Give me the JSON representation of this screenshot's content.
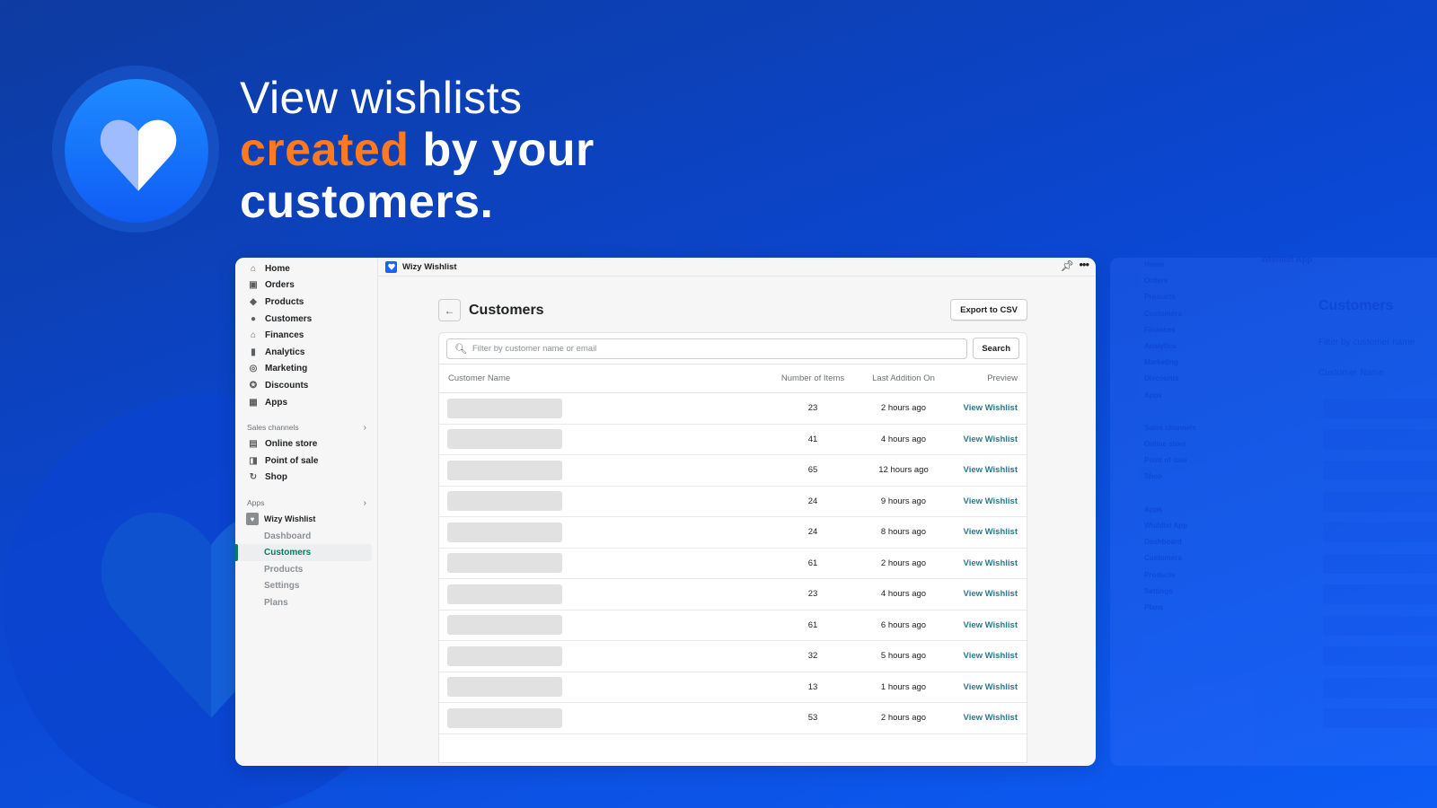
{
  "hero": {
    "line1": "View wishlists",
    "line2_accent": "created",
    "line2_rest": " by your",
    "line3": "customers.",
    "accent_color": "#ff7a1f",
    "logo_icon": "heart-icon"
  },
  "app": {
    "topbar": {
      "app_name": "Wizy Wishlist",
      "pin_icon": "pin-icon",
      "more_icon": "more-icon"
    },
    "sidebar": {
      "main_items": [
        {
          "label": "Home",
          "icon": "home-icon"
        },
        {
          "label": "Orders",
          "icon": "orders-icon"
        },
        {
          "label": "Products",
          "icon": "tag-icon"
        },
        {
          "label": "Customers",
          "icon": "person-icon"
        },
        {
          "label": "Finances",
          "icon": "bank-icon"
        },
        {
          "label": "Analytics",
          "icon": "bar-chart-icon"
        },
        {
          "label": "Marketing",
          "icon": "target-icon"
        },
        {
          "label": "Discounts",
          "icon": "discount-icon"
        },
        {
          "label": "Apps",
          "icon": "apps-icon"
        }
      ],
      "sales_channels_label": "Sales channels",
      "sales_channels": [
        {
          "label": "Online store",
          "icon": "store-icon"
        },
        {
          "label": "Point of sale",
          "icon": "pos-icon"
        },
        {
          "label": "Shop",
          "icon": "shop-icon"
        }
      ],
      "apps_label": "Apps",
      "app_name": "Wizy Wishlist",
      "app_subitems": [
        {
          "label": "Dashboard",
          "active": false
        },
        {
          "label": "Customers",
          "active": true
        },
        {
          "label": "Products",
          "active": false
        },
        {
          "label": "Settings",
          "active": false
        },
        {
          "label": "Plans",
          "active": false
        }
      ]
    },
    "page": {
      "title": "Customers",
      "export_label": "Export to CSV",
      "search_placeholder": "Filter by customer name or email",
      "search_button": "Search",
      "columns": [
        "Customer Name",
        "Number of Items",
        "Last Addition On",
        "Preview"
      ],
      "rows": [
        {
          "items": "23",
          "last": "2 hours ago",
          "preview": "View Wishlist"
        },
        {
          "items": "41",
          "last": "4 hours ago",
          "preview": "View Wishlist"
        },
        {
          "items": "65",
          "last": "12 hours ago",
          "preview": "View Wishlist"
        },
        {
          "items": "24",
          "last": "9 hours ago",
          "preview": "View Wishlist"
        },
        {
          "items": "24",
          "last": "8 hours ago",
          "preview": "View Wishlist"
        },
        {
          "items": "61",
          "last": "2 hours ago",
          "preview": "View Wishlist"
        },
        {
          "items": "23",
          "last": "4 hours ago",
          "preview": "View Wishlist"
        },
        {
          "items": "61",
          "last": "6 hours ago",
          "preview": "View Wishlist"
        },
        {
          "items": "32",
          "last": "5 hours ago",
          "preview": "View Wishlist"
        },
        {
          "items": "13",
          "last": "1 hours ago",
          "preview": "View Wishlist"
        },
        {
          "items": "53",
          "last": "2 hours ago",
          "preview": "View Wishlist"
        }
      ]
    }
  },
  "ghost": {
    "app_name": "Wishlist App",
    "title": "Customers",
    "search_placeholder": "Filter by customer name",
    "column": "Customer Name",
    "sidebar": [
      "Home",
      "Orders",
      "Products",
      "Customers",
      "Finances",
      "Analytics",
      "Marketing",
      "Discounts",
      "Apps"
    ],
    "sales_channels_label": "Sales channels",
    "sales_channels": [
      "Online store",
      "Point of sale",
      "Shop"
    ],
    "apps_label": "Apps",
    "app_subitems": [
      "Dashboard",
      "Customers",
      "Products",
      "Settings",
      "Plans"
    ]
  }
}
